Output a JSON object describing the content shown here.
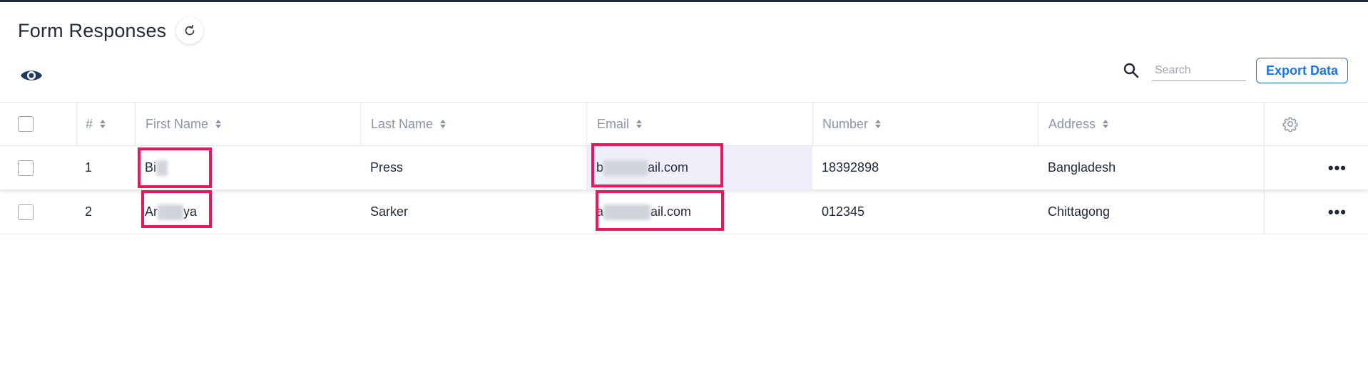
{
  "header": {
    "title": "Form Responses",
    "refresh_icon": "refresh-icon"
  },
  "toolbar": {
    "visibility_icon": "eye-icon",
    "search_icon": "search-icon",
    "search_placeholder": "Search",
    "search_value": "",
    "export_label": "Export Data"
  },
  "table": {
    "columns": [
      {
        "label": "#"
      },
      {
        "label": "First Name"
      },
      {
        "label": "Last Name"
      },
      {
        "label": "Email"
      },
      {
        "label": "Number"
      },
      {
        "label": "Address"
      }
    ],
    "settings_icon": "gear-icon",
    "rows": [
      {
        "index": "1",
        "first_name_visible": "Bi",
        "last_name": "Press",
        "email_prefix": "b",
        "email_suffix": "ail.com",
        "number": "18392898",
        "address": "Bangladesh"
      },
      {
        "index": "2",
        "first_name_visible": "Ar",
        "first_name_end": "ya",
        "last_name": "Sarker",
        "email_prefix": "a",
        "email_suffix": "ail.com",
        "number": "012345",
        "address": "Chittagong"
      }
    ],
    "row_actions_label": "•••"
  },
  "colors": {
    "accent": "#1a73e8",
    "highlight_box": "#f0145a",
    "selected_cell": "#efeffb"
  }
}
